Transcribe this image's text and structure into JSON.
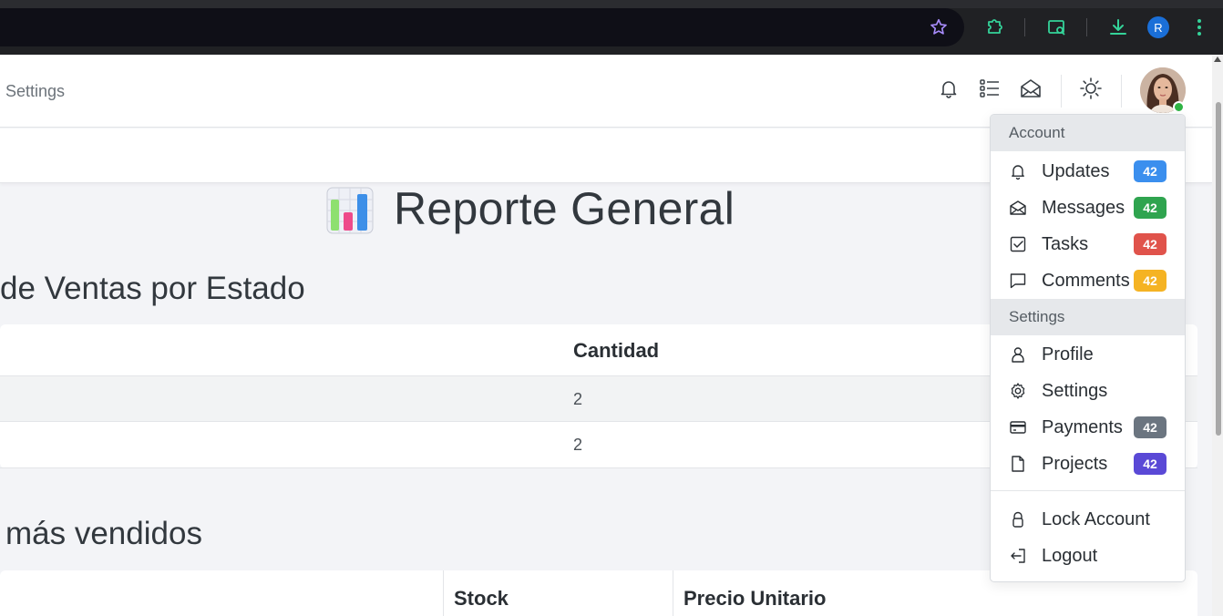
{
  "browser": {
    "profile_initial": "R",
    "icons": [
      "star-icon",
      "extensions-icon",
      "tab-search-icon",
      "download-icon",
      "more-vert-icon"
    ]
  },
  "topbar": {
    "breadcrumb": "Settings",
    "icons": [
      "bell-icon",
      "list-icon",
      "mail-open-icon",
      "sun-icon"
    ],
    "avatar_status": "online"
  },
  "main": {
    "report_title": "Reporte General",
    "section1": {
      "title": "de Ventas por Estado",
      "column_header": "Cantidad",
      "rows": [
        "2",
        "2"
      ]
    },
    "section2": {
      "title": "más vendidos",
      "column_headers": [
        "Stock",
        "Precio Unitario"
      ]
    }
  },
  "dropdown": {
    "account_header": "Account",
    "account_items": [
      {
        "label": "Updates",
        "icon": "bell-icon",
        "badge": "42",
        "badge_color": "#3b8fee"
      },
      {
        "label": "Messages",
        "icon": "mail-open-icon",
        "badge": "42",
        "badge_color": "#2fa44f"
      },
      {
        "label": "Tasks",
        "icon": "checkbox-icon",
        "badge": "42",
        "badge_color": "#e0534b"
      },
      {
        "label": "Comments",
        "icon": "comment-icon",
        "badge": "42",
        "badge_color": "#f5b323"
      }
    ],
    "settings_header": "Settings",
    "settings_items": [
      {
        "label": "Profile",
        "icon": "user-icon",
        "badge": "",
        "badge_color": ""
      },
      {
        "label": "Settings",
        "icon": "gear-icon",
        "badge": "",
        "badge_color": ""
      },
      {
        "label": "Payments",
        "icon": "credit-card-icon",
        "badge": "42",
        "badge_color": "#6b7580"
      },
      {
        "label": "Projects",
        "icon": "file-icon",
        "badge": "42",
        "badge_color": "#5a49d6"
      }
    ],
    "footer_items": [
      {
        "label": "Lock Account",
        "icon": "lock-icon"
      },
      {
        "label": "Logout",
        "icon": "logout-icon"
      }
    ]
  }
}
